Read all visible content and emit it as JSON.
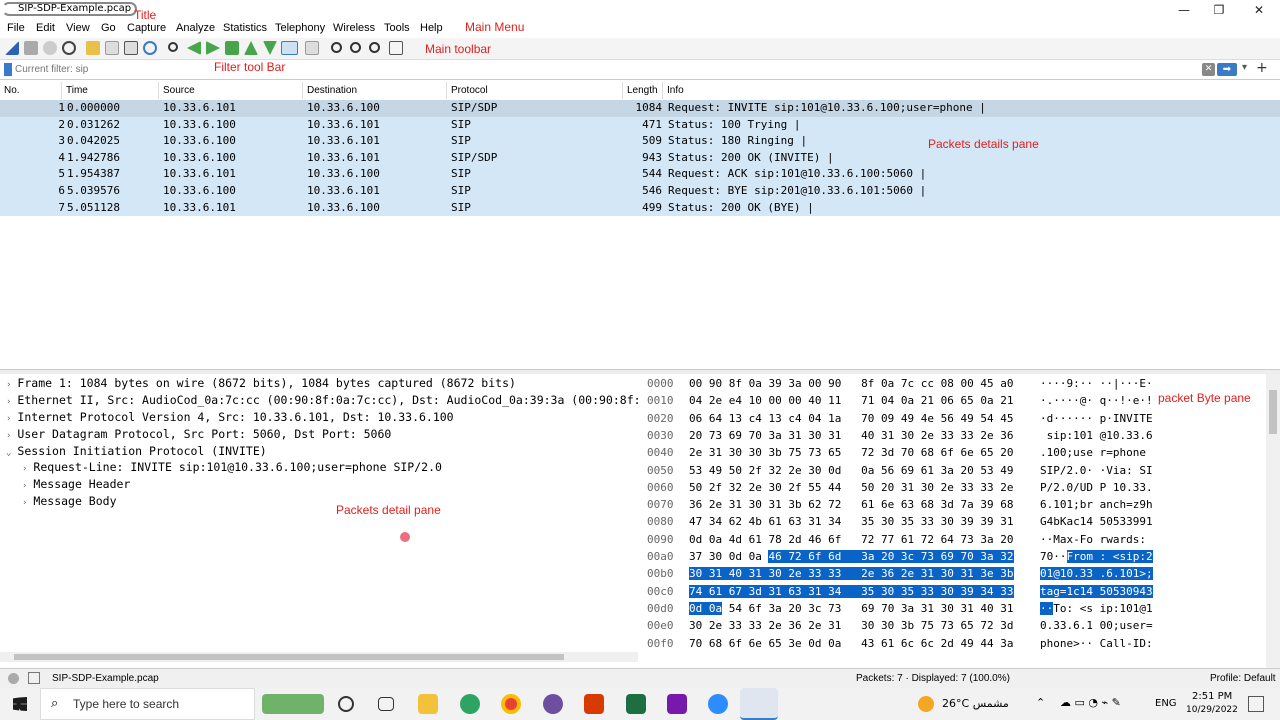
{
  "window": {
    "title": "SIP-SDP-Example.pcap",
    "minimize": "—",
    "maximize": "❐",
    "close": "✕"
  },
  "annotations": {
    "title": "Title",
    "main_menu": "Main Menu",
    "main_toolbar": "Main toolbar",
    "filter_bar": "Filter tool Bar",
    "packets_details_top": "Packets details pane",
    "packets_details_bottom": "Packets detail pane",
    "packet_byte": "packet Byte pane"
  },
  "menu": [
    "File",
    "Edit",
    "View",
    "Go",
    "Capture",
    "Analyze",
    "Statistics",
    "Telephony",
    "Wireless",
    "Tools",
    "Help"
  ],
  "filter": {
    "placeholder": "Current filter: sip"
  },
  "packet_columns": [
    "No.",
    "Time",
    "Source",
    "Destination",
    "Protocol",
    "Length",
    "Info"
  ],
  "packets": [
    {
      "no": "1",
      "time": "0.000000",
      "src": "10.33.6.101",
      "dst": "10.33.6.100",
      "proto": "SIP/SDP",
      "len": "1084",
      "info": "Request: INVITE sip:101@10.33.6.100;user=phone |"
    },
    {
      "no": "2",
      "time": "0.031262",
      "src": "10.33.6.100",
      "dst": "10.33.6.101",
      "proto": "SIP",
      "len": "471",
      "info": "Status: 100 Trying |"
    },
    {
      "no": "3",
      "time": "0.042025",
      "src": "10.33.6.100",
      "dst": "10.33.6.101",
      "proto": "SIP",
      "len": "509",
      "info": "Status: 180 Ringing |"
    },
    {
      "no": "4",
      "time": "1.942786",
      "src": "10.33.6.100",
      "dst": "10.33.6.101",
      "proto": "SIP/SDP",
      "len": "943",
      "info": "Status: 200 OK (INVITE) |"
    },
    {
      "no": "5",
      "time": "1.954387",
      "src": "10.33.6.101",
      "dst": "10.33.6.100",
      "proto": "SIP",
      "len": "544",
      "info": "Request: ACK sip:101@10.33.6.100:5060 |"
    },
    {
      "no": "6",
      "time": "5.039576",
      "src": "10.33.6.100",
      "dst": "10.33.6.101",
      "proto": "SIP",
      "len": "546",
      "info": "Request: BYE sip:201@10.33.6.101:5060 |"
    },
    {
      "no": "7",
      "time": "5.051128",
      "src": "10.33.6.101",
      "dst": "10.33.6.100",
      "proto": "SIP",
      "len": "499",
      "info": "Status: 200 OK (BYE) |"
    }
  ],
  "details": [
    "Frame 1: 1084 bytes on wire (8672 bits), 1084 bytes captured (8672 bits)",
    "Ethernet II, Src: AudioCod_0a:7c:cc (00:90:8f:0a:7c:cc), Dst: AudioCod_0a:39:3a (00:90:8f:",
    "Internet Protocol Version 4, Src: 10.33.6.101, Dst: 10.33.6.100",
    "User Datagram Protocol, Src Port: 5060, Dst Port: 5060",
    "Session Initiation Protocol (INVITE)",
    "Request-Line: INVITE sip:101@10.33.6.100;user=phone SIP/2.0",
    "Message Header",
    "Message Body"
  ],
  "bytes": [
    {
      "off": "0000",
      "hex": "00 90 8f 0a 39 3a 00 90   8f 0a 7c cc 08 00 45 a0",
      "ascii": "····9:·· ··|···E·"
    },
    {
      "off": "0010",
      "hex": "04 2e e4 10 00 00 40 11   71 04 0a 21 06 65 0a 21",
      "ascii": "·.····@· q··!·e·!"
    },
    {
      "off": "0020",
      "hex": "06 64 13 c4 13 c4 04 1a   70 09 49 4e 56 49 54 45",
      "ascii": "·d······ p·INVITE"
    },
    {
      "off": "0030",
      "hex": "20 73 69 70 3a 31 30 31   40 31 30 2e 33 33 2e 36",
      "ascii": " sip:101 @10.33.6"
    },
    {
      "off": "0040",
      "hex": "2e 31 30 30 3b 75 73 65   72 3d 70 68 6f 6e 65 20",
      "ascii": ".100;use r=phone "
    },
    {
      "off": "0050",
      "hex": "53 49 50 2f 32 2e 30 0d   0a 56 69 61 3a 20 53 49",
      "ascii": "SIP/2.0· ·Via: SI"
    },
    {
      "off": "0060",
      "hex": "50 2f 32 2e 30 2f 55 44   50 20 31 30 2e 33 33 2e",
      "ascii": "P/2.0/UD P 10.33."
    },
    {
      "off": "0070",
      "hex": "36 2e 31 30 31 3b 62 72   61 6e 63 68 3d 7a 39 68",
      "ascii": "6.101;br anch=z9h"
    },
    {
      "off": "0080",
      "hex": "47 34 62 4b 61 63 31 34   35 30 35 33 30 39 39 31",
      "ascii": "G4bKac14 50533991"
    },
    {
      "off": "0090",
      "hex": "0d 0a 4d 61 78 2d 46 6f   72 77 61 72 64 73 3a 20",
      "ascii": "··Max-Fo rwards: "
    },
    {
      "off": "00a0",
      "hex": "37 30 0d 0a ",
      "hexhl": "46 72 6f 6d   3a 20 3c 73 69 70 3a 32",
      "ascii": "70··",
      "asciihl": "From : <sip:2"
    },
    {
      "off": "00b0",
      "hexhl": "30 31 40 31 30 2e 33 33   2e 36 2e 31 30 31 3e 3b",
      "asciihl": "01@10.33 .6.101>;"
    },
    {
      "off": "00c0",
      "hexhl": "74 61 67 3d 31 63 31 34   35 30 35 33 30 39 34 33",
      "asciihl": "tag=1c14 50530943"
    },
    {
      "off": "00d0",
      "hexhl": "0d 0a",
      "hex": " 54 6f 3a 20 3c 73   69 70 3a 31 30 31 40 31",
      "asciihl": "··",
      "ascii": "To: <s ip:101@1"
    },
    {
      "off": "00e0",
      "hex": "30 2e 33 33 2e 36 2e 31   30 30 3b 75 73 65 72 3d",
      "ascii": "0.33.6.1 00;user="
    },
    {
      "off": "00f0",
      "hex": "70 68 6f 6e 65 3e 0d 0a   43 61 6c 6c 2d 49 44 3a",
      "ascii": "phone>·· Call-ID:"
    }
  ],
  "status": {
    "file": "SIP-SDP-Example.pcap",
    "packets": "Packets: 7 · Displayed: 7 (100.0%)",
    "profile": "Profile: Default"
  },
  "taskbar": {
    "search_placeholder": "Type here to search",
    "weather": "26°C مشمس",
    "lang": "ENG",
    "time": "2:51 PM",
    "date": "10/29/2022"
  }
}
